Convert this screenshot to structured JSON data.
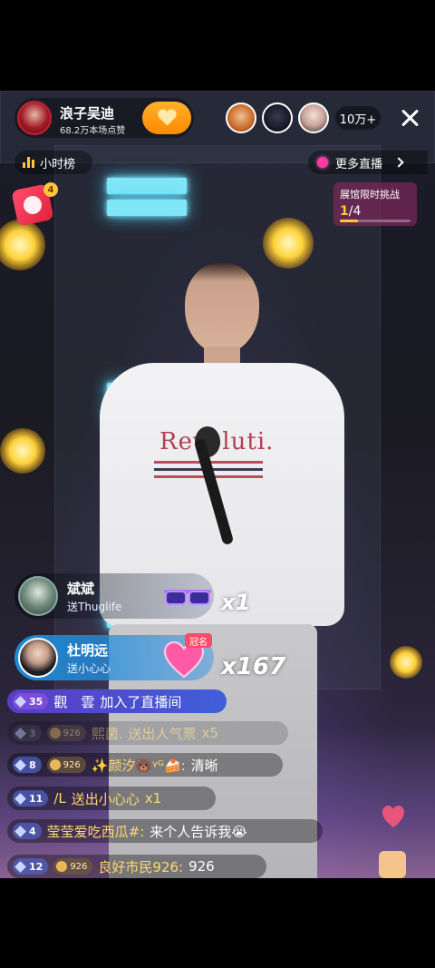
{
  "host": {
    "name": "浪子吴迪",
    "likes": "68.2万本场点赞"
  },
  "viewers": {
    "count": "10万+"
  },
  "ranking": {
    "label": "小时榜"
  },
  "more_live": {
    "label": "更多直播"
  },
  "gift_badge": {
    "count": "4"
  },
  "challenge": {
    "title": "展馆限时挑战",
    "current": "1",
    "total": "/4",
    "progress_fraction": 0.25
  },
  "stage": {
    "shirt_text": "Revoluti."
  },
  "gifts": [
    {
      "user": "斌斌",
      "action": "送Thuglife",
      "count": "x1",
      "icon": "sunglasses-icon"
    },
    {
      "user": "杜明远",
      "action": "送小心心",
      "count": "x167",
      "tag": "冠名",
      "icon": "heart-gift-icon"
    }
  ],
  "chat": [
    {
      "level": "35",
      "user": "觀　雲",
      "text": "加入了直播间",
      "type": "join"
    },
    {
      "level": "3",
      "fan": "926",
      "user": "熙菌.",
      "text": "送出人气票",
      "suffix": "x5",
      "type": "faded"
    },
    {
      "level": "8",
      "fan": "926",
      "user": "✨颜汐🐻ᵞᴳ🍰:",
      "text": "清晰",
      "type": "normal"
    },
    {
      "level": "11",
      "user": "/L",
      "text": "送出小心心",
      "suffix": "x1",
      "type": "gift"
    },
    {
      "level": "4",
      "user": "莹莹爱吃西瓜#:",
      "text": "来个人告诉我😭",
      "type": "normal"
    },
    {
      "level": "12",
      "fan": "926",
      "user": "良好市民926:",
      "text": "926",
      "type": "normal"
    }
  ],
  "colors": {
    "accent_orange": "#ff8a00",
    "username_yellow": "#ffd86e",
    "gift_blue": "#1c8ad8",
    "join_purple": "#5b3cc4",
    "close_icon": "close-icon",
    "follow_icon": "heart-plus-icon"
  }
}
